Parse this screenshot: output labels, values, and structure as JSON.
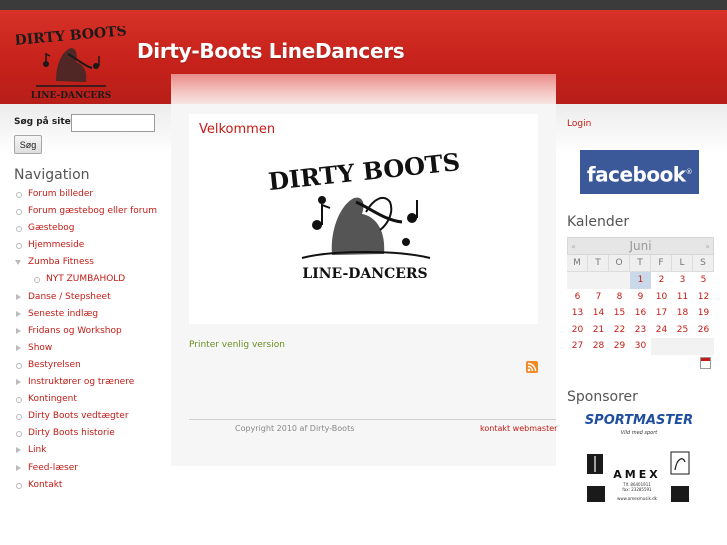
{
  "header": {
    "site_title": "Dirty-Boots LineDancers",
    "logo_text_top": "DIRTY BOOTS",
    "logo_text_bottom": "LINE-DANCERS"
  },
  "search": {
    "label": "Søg på sitet:",
    "value": "",
    "placeholder": "",
    "button_label": "Søg"
  },
  "navigation": {
    "title": "Navigation",
    "items": [
      {
        "label": "Forum billeder",
        "marker": "bullet"
      },
      {
        "label": "Forum gæstebog eller forum",
        "marker": "bullet"
      },
      {
        "label": "Gæstebog",
        "marker": "bullet"
      },
      {
        "label": "Hjemmeside",
        "marker": "bullet"
      },
      {
        "label": "Zumba Fitness",
        "marker": "expanded"
      },
      {
        "label": "NYT ZUMBAHOLD",
        "marker": "sub-bullet"
      },
      {
        "label": "Danse / Stepsheet",
        "marker": "collapsed"
      },
      {
        "label": "Seneste indlæg",
        "marker": "collapsed"
      },
      {
        "label": "Fridans og Workshop",
        "marker": "collapsed"
      },
      {
        "label": "Show",
        "marker": "collapsed"
      },
      {
        "label": "Bestyrelsen",
        "marker": "bullet"
      },
      {
        "label": "Instruktører og trænere",
        "marker": "collapsed"
      },
      {
        "label": "Kontingent",
        "marker": "bullet"
      },
      {
        "label": "Dirty Boots vedtægter",
        "marker": "bullet"
      },
      {
        "label": "Dirty Boots historie",
        "marker": "bullet"
      },
      {
        "label": "Link",
        "marker": "collapsed"
      },
      {
        "label": "Feed-læser",
        "marker": "collapsed"
      },
      {
        "label": "Kontakt",
        "marker": "bullet"
      }
    ]
  },
  "main": {
    "heading": "Velkommen",
    "logo_text_top": "DIRTY BOOTS",
    "logo_text_bottom": "LINE-DANCERS",
    "printer_link": "Printer venlig version",
    "rss_icon": "rss-feed-icon"
  },
  "footer": {
    "copyright": "Copyright 2010 af Dirty-Boots",
    "contact_link": "kontakt webmaster"
  },
  "right": {
    "login": "Login",
    "facebook_label": "facebook",
    "calendar": {
      "title": "Kalender",
      "month": "Juni",
      "prev": "«",
      "next": "»",
      "weekdays": [
        "M",
        "T",
        "O",
        "T",
        "F",
        "L",
        "S"
      ],
      "days": [
        "",
        "",
        "",
        "1",
        "2",
        "3",
        "5",
        "6",
        "7",
        "8",
        "9",
        "10",
        "11",
        "12",
        "13",
        "14",
        "15",
        "16",
        "17",
        "18",
        "19",
        "20",
        "21",
        "22",
        "23",
        "24",
        "25",
        "26",
        "27",
        "28",
        "29",
        "30",
        "",
        "",
        ""
      ],
      "today": "1"
    },
    "sponsors_title": "Sponsorer",
    "sponsor1_text": "SPORTMASTER",
    "sponsor1_tagline": "Vild med sport",
    "sponsor2_text": "AMEX",
    "sponsor2_phone": "Tlf. 86401911",
    "sponsor2_fax": "fax: 23285591",
    "sponsor2_url": "www.amexmusik.dk"
  },
  "colors": {
    "header_red": "#c6221b",
    "link_red": "#c21b14",
    "facebook_blue": "#3b5998",
    "printer_green": "#6b8e23"
  }
}
